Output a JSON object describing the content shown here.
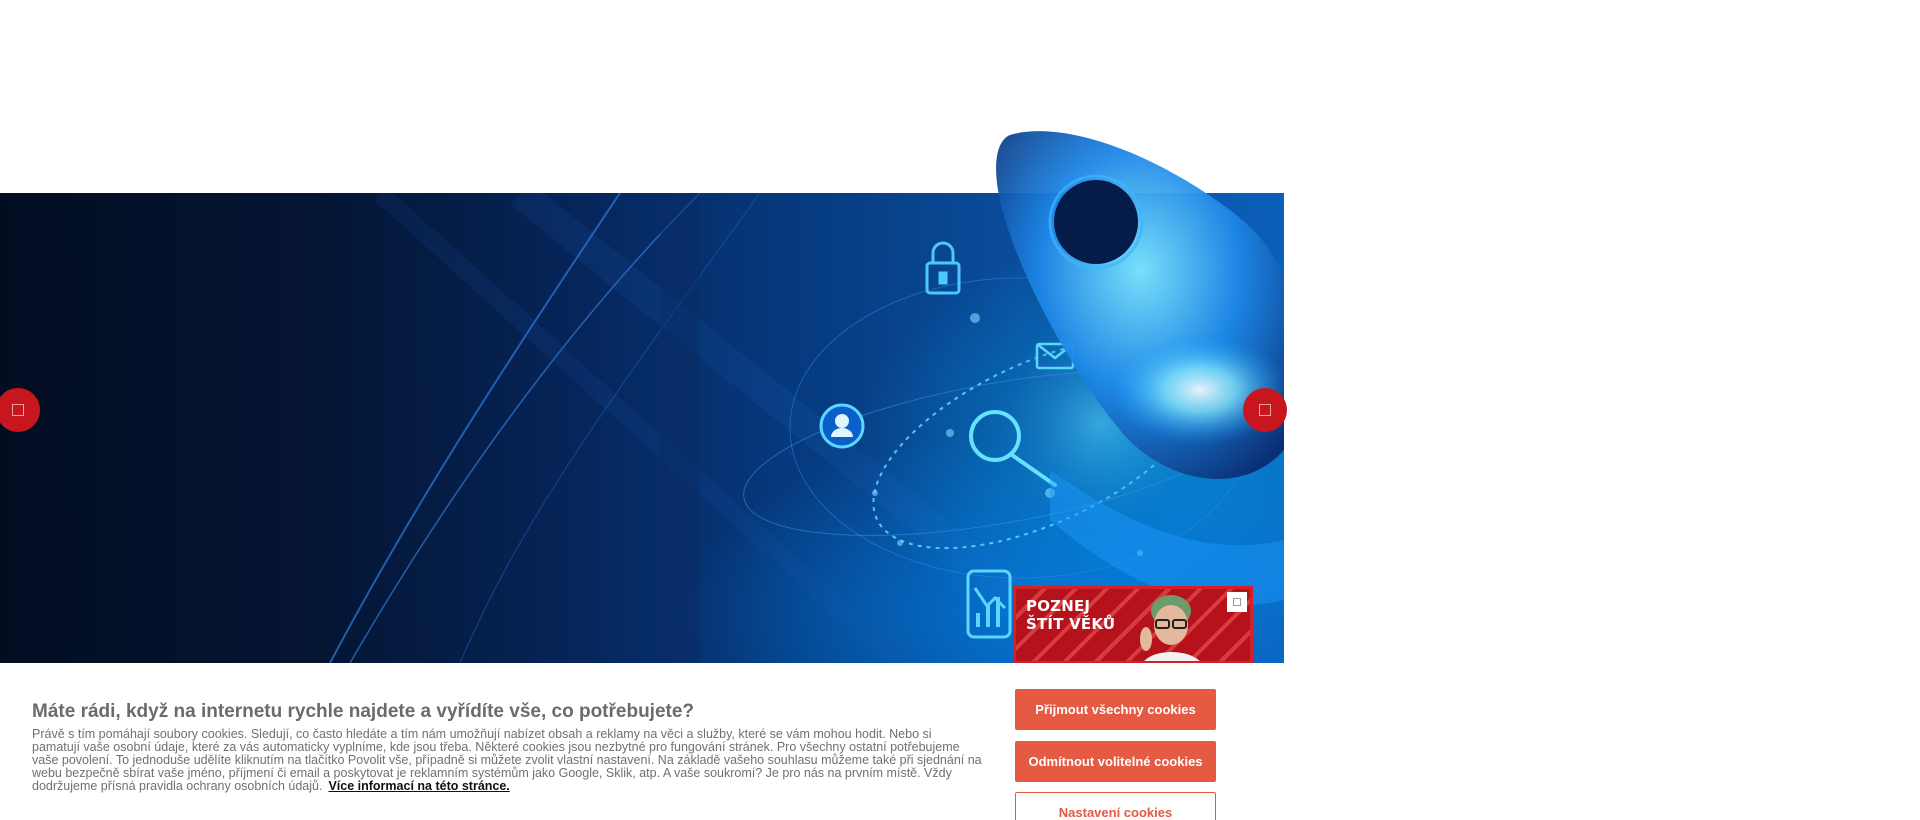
{
  "hero": {
    "slider_prev_icon": "chevron-left-icon",
    "slider_next_icon": "chevron-right-icon",
    "illustration_icons": [
      "lock-icon",
      "user-icon",
      "mail-icon",
      "search-icon",
      "phone-chart-icon"
    ]
  },
  "promo": {
    "line1": "POZNEJ",
    "line2": "ŠTÍT VĚKŮ",
    "close_icon": "close-icon"
  },
  "cookie": {
    "title": "Máte rádi, když na internetu rychle najdete a vyřídíte vše, co potřebujete?",
    "body": "Právě s tím pomáhají soubory cookies. Sledují, co často hledáte a tím nám umožňují nabízet obsah a reklamy na věci a služby, které se vám mohou hodit. Nebo si pamatují vaše osobní údaje, které za vás automaticky vyplníme, kde jsou třeba. Některé cookies jsou nezbytné pro fungování stránek. Pro všechny ostatní potřebujeme vaše povolení. To jednoduše udělíte kliknutím na tlačítko Povolit vše, případně si můžete zvolit vlastní nastavení. Na základě vašeho souhlasu můžeme také při sjednání na webu bezpečně sbírat vaše jméno, příjmení či email a poskytovat je reklamním systémům jako Google, Sklik, atp. A vaše soukromí? Je pro nás na prvním místě. Vždy dodržujeme přísná pravidla ochrany osobních údajů.",
    "more_link": "Více informací na této stránce.",
    "accept_all": "Přijmout všechny cookies",
    "reject_optional": "Odmítnout volitelné cookies",
    "settings": "Nastavení cookies"
  },
  "colors": {
    "accent": "#e45a43",
    "slider_arrow": "#c8161e",
    "promo_bg": "#b5121b"
  }
}
